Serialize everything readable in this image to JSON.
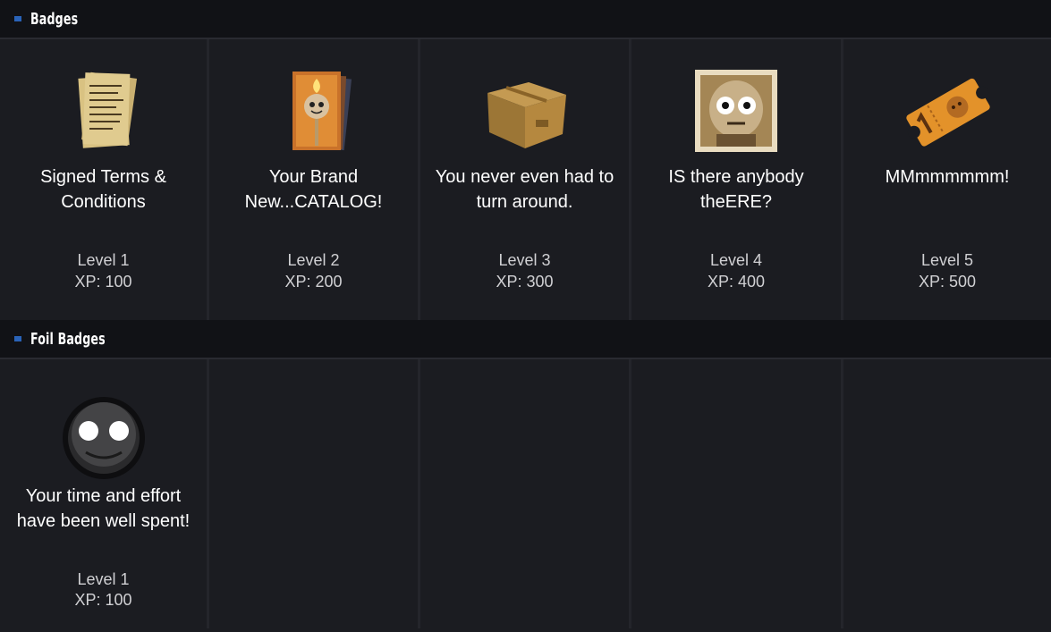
{
  "sections": {
    "badges": {
      "title": "Badges",
      "items": [
        {
          "name": "Signed Terms & Conditions",
          "level": "Level 1",
          "xp": "XP: 100",
          "icon": "signed-documents-icon"
        },
        {
          "name": "Your Brand New...CATALOG!",
          "level": "Level 2",
          "xp": "XP: 200",
          "icon": "catalog-book-icon"
        },
        {
          "name": "You never even had to turn around.",
          "level": "Level 3",
          "xp": "XP: 300",
          "icon": "cardboard-box-icon"
        },
        {
          "name": "IS there anybody theERE?",
          "level": "Level 4",
          "xp": "XP: 400",
          "icon": "creepy-photo-icon"
        },
        {
          "name": "MMmmmmmm!",
          "level": "Level 5",
          "xp": "XP: 500",
          "icon": "ticket-icon"
        }
      ]
    },
    "foil": {
      "title": "Foil Badges",
      "items": [
        {
          "name": "Your time and effort have been well spent!",
          "level": "Level 1",
          "xp": "XP: 100",
          "icon": "glowing-eyes-face-icon"
        }
      ]
    }
  },
  "colors": {
    "background": "#1b1c21",
    "header": "#111216",
    "accent": "#2a63b8"
  }
}
